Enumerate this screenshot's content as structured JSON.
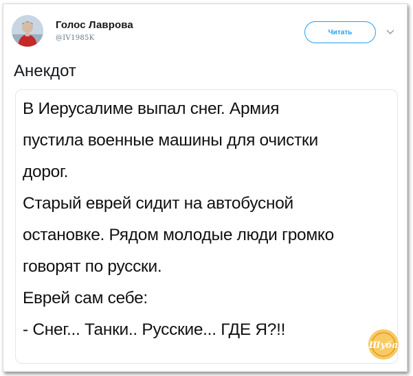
{
  "tweet": {
    "author": {
      "name": "Голос Лаврова",
      "handle": "@IV1985K"
    },
    "follow_label": "Читать",
    "text": "Анекдот"
  },
  "image": {
    "lines": [
      "В Иерусалиме выпал снег. Армия",
      "пустила военные машины для очистки",
      "дорог.",
      "Старый еврей сидит на автобусной",
      "остановке. Рядом молодые люди громко",
      "говорят по русски.",
      "Еврей сам себе:",
      "- Снег... Танки.. Русские... ГДЕ Я?!!"
    ],
    "watermark_text": "Шуба"
  },
  "colors": {
    "accent": "#1da1f2",
    "text": "#14171a",
    "muted": "#657786",
    "watermark": "#f0b233"
  },
  "icons": {
    "caret": "chevron-down-icon",
    "avatar": "avatar"
  }
}
